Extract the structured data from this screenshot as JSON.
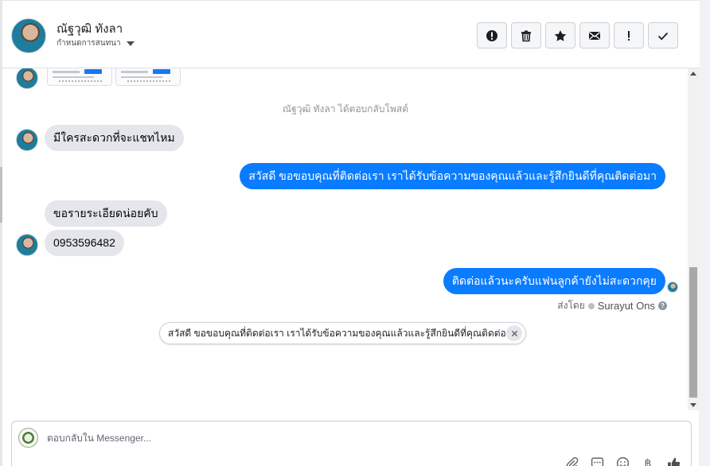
{
  "header": {
    "contact_name": "ณัฐวุฒิ ทังลา",
    "conversation_status": "กำหนดการสนทนา",
    "actions": [
      {
        "icon": "alert-circle-icon",
        "name": "mark-spam-button"
      },
      {
        "icon": "trash-icon",
        "name": "delete-button"
      },
      {
        "icon": "star-icon",
        "name": "star-button"
      },
      {
        "icon": "envelope-icon",
        "name": "mark-unread-button"
      },
      {
        "icon": "exclamation-icon",
        "name": "follow-up-button"
      },
      {
        "icon": "check-icon",
        "name": "mark-done-button"
      }
    ]
  },
  "thread": {
    "system_note": "ณัฐวุฒิ ทังลา ได้ตอบกลับโพสต์",
    "messages": [
      {
        "from": "contact",
        "text": "มีใครสะดวกที่จะแชทไหม"
      },
      {
        "from": "page",
        "text": "สวัสดี ขอขอบคุณที่ติดต่อเรา เราได้รับข้อความของคุณแล้วและรู้สึกยินดีที่คุณติดต่อมา"
      },
      {
        "from": "contact",
        "text": "ขอรายระเอียดน่อยคับ"
      },
      {
        "from": "contact",
        "text": "0953596482"
      },
      {
        "from": "page",
        "text": "ติดต่อแล้วนะครับแฟนลูกค้ายังไม่สะดวกคุย"
      }
    ],
    "sent_by_label": "ส่งโดย",
    "sent_by_agent": "Surayut Ons",
    "help_glyph": "?",
    "saved_reply": "สวัสดี ขอขอบคุณที่ติดต่อเรา เราได้รับข้อความของคุณแล้วและรู้สึกยินดีที่คุณติดต่อมา"
  },
  "composer": {
    "placeholder": "ตอบกลับใน Messenger...",
    "value": "",
    "currency_glyph": "฿"
  },
  "colors": {
    "outgoing_bubble": "#0a7cff",
    "incoming_bubble": "#e4e6eb",
    "accent": "#1877f2"
  }
}
